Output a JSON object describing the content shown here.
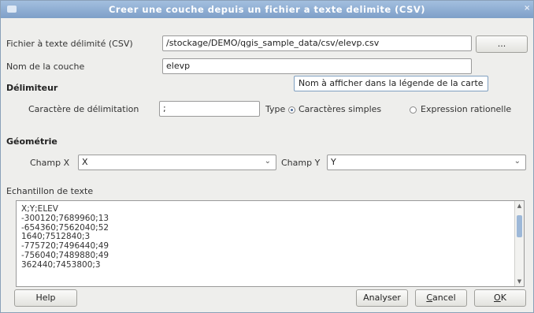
{
  "window": {
    "title": "Creer une couche depuis un fichier a texte delimite (CSV)"
  },
  "file": {
    "label": "Fichier à texte délimité (CSV)",
    "value": "/stockage/DEMO/qgis_sample_data/csv/elevp.csv",
    "browse_label": "..."
  },
  "layer": {
    "label": "Nom de la couche",
    "value": "elevp"
  },
  "tooltip": {
    "text": "Nom à afficher dans la légende de la carte"
  },
  "delimiter": {
    "heading": "Délimiteur",
    "char_label": "Caractère de délimitation",
    "char_value": ";",
    "type_label": "Type",
    "option_simple": "Caractères simples",
    "option_regex": "Expression rationelle",
    "selected": "Caractères simples"
  },
  "geometry": {
    "heading": "Géométrie",
    "x_label": "Champ X",
    "x_value": "X",
    "y_label": "Champ Y",
    "y_value": "Y"
  },
  "sample": {
    "heading": "Echantillon de texte",
    "lines": [
      "X;Y;ELEV",
      "-300120;7689960;13",
      "-654360;7562040;52",
      "1640;7512840;3",
      "-775720;7496440;49",
      "-756040;7489880;49",
      "362440;7453800;3"
    ]
  },
  "buttons": {
    "help": "Help",
    "analyze": "Analyser",
    "cancel_first": "C",
    "cancel_rest": "ancel",
    "ok_first": "O",
    "ok_rest": "K"
  },
  "colors": {
    "titlebar": "#8aa8d0",
    "accent": "#4b6b9a"
  },
  "icons": {
    "menu": "window-menu-icon",
    "close": "close-icon",
    "combo": "chevron-down-icon"
  }
}
